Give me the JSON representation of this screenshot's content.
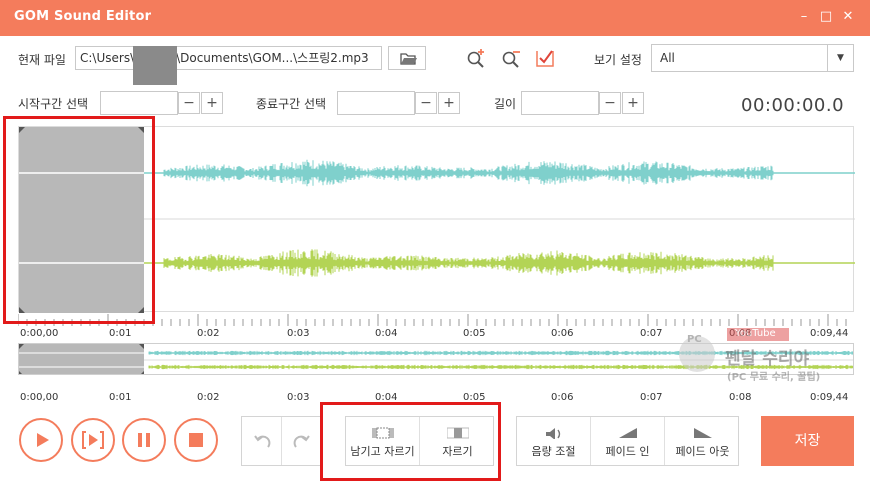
{
  "window": {
    "title": "GOM Sound Editor",
    "minimize_icon": "minimize-icon",
    "maximize_icon": "maximize-icon",
    "close_icon": "close-icon"
  },
  "file": {
    "label": "현재 파일",
    "path": "C:\\Users\\           \\Documents\\GOM...\\스프링2.mp3"
  },
  "view": {
    "label": "보기 설정",
    "value": "All"
  },
  "start": {
    "label": "시작구간 선택",
    "value": ""
  },
  "end": {
    "label": "종료구간 선택",
    "value": ""
  },
  "length": {
    "label": "길이",
    "value": ""
  },
  "timecode": "00:00:00.0",
  "ruler": {
    "labels": [
      "0:00,00",
      "0:01",
      "0:02",
      "0:03",
      "0:04",
      "0:05",
      "0:06",
      "0:07",
      "0:08",
      "0:09,44"
    ]
  },
  "buttons": {
    "keep_cut": "남기고 자르기",
    "cut": "자르기",
    "volume": "음량 조절",
    "fade_in": "페이드 인",
    "fade_out": "페이드 아웃",
    "save": "저장"
  },
  "watermark": {
    "line1": "PC",
    "line2": "YouTube",
    "line3": "펜달 수리야",
    "line4": "(PC 무료 수리, 꿀팁)"
  },
  "colors": {
    "accent": "#f47c5c",
    "wave_top": "#7fd0cc",
    "wave_bottom": "#b3d455",
    "highlight": "#e21a1a"
  }
}
